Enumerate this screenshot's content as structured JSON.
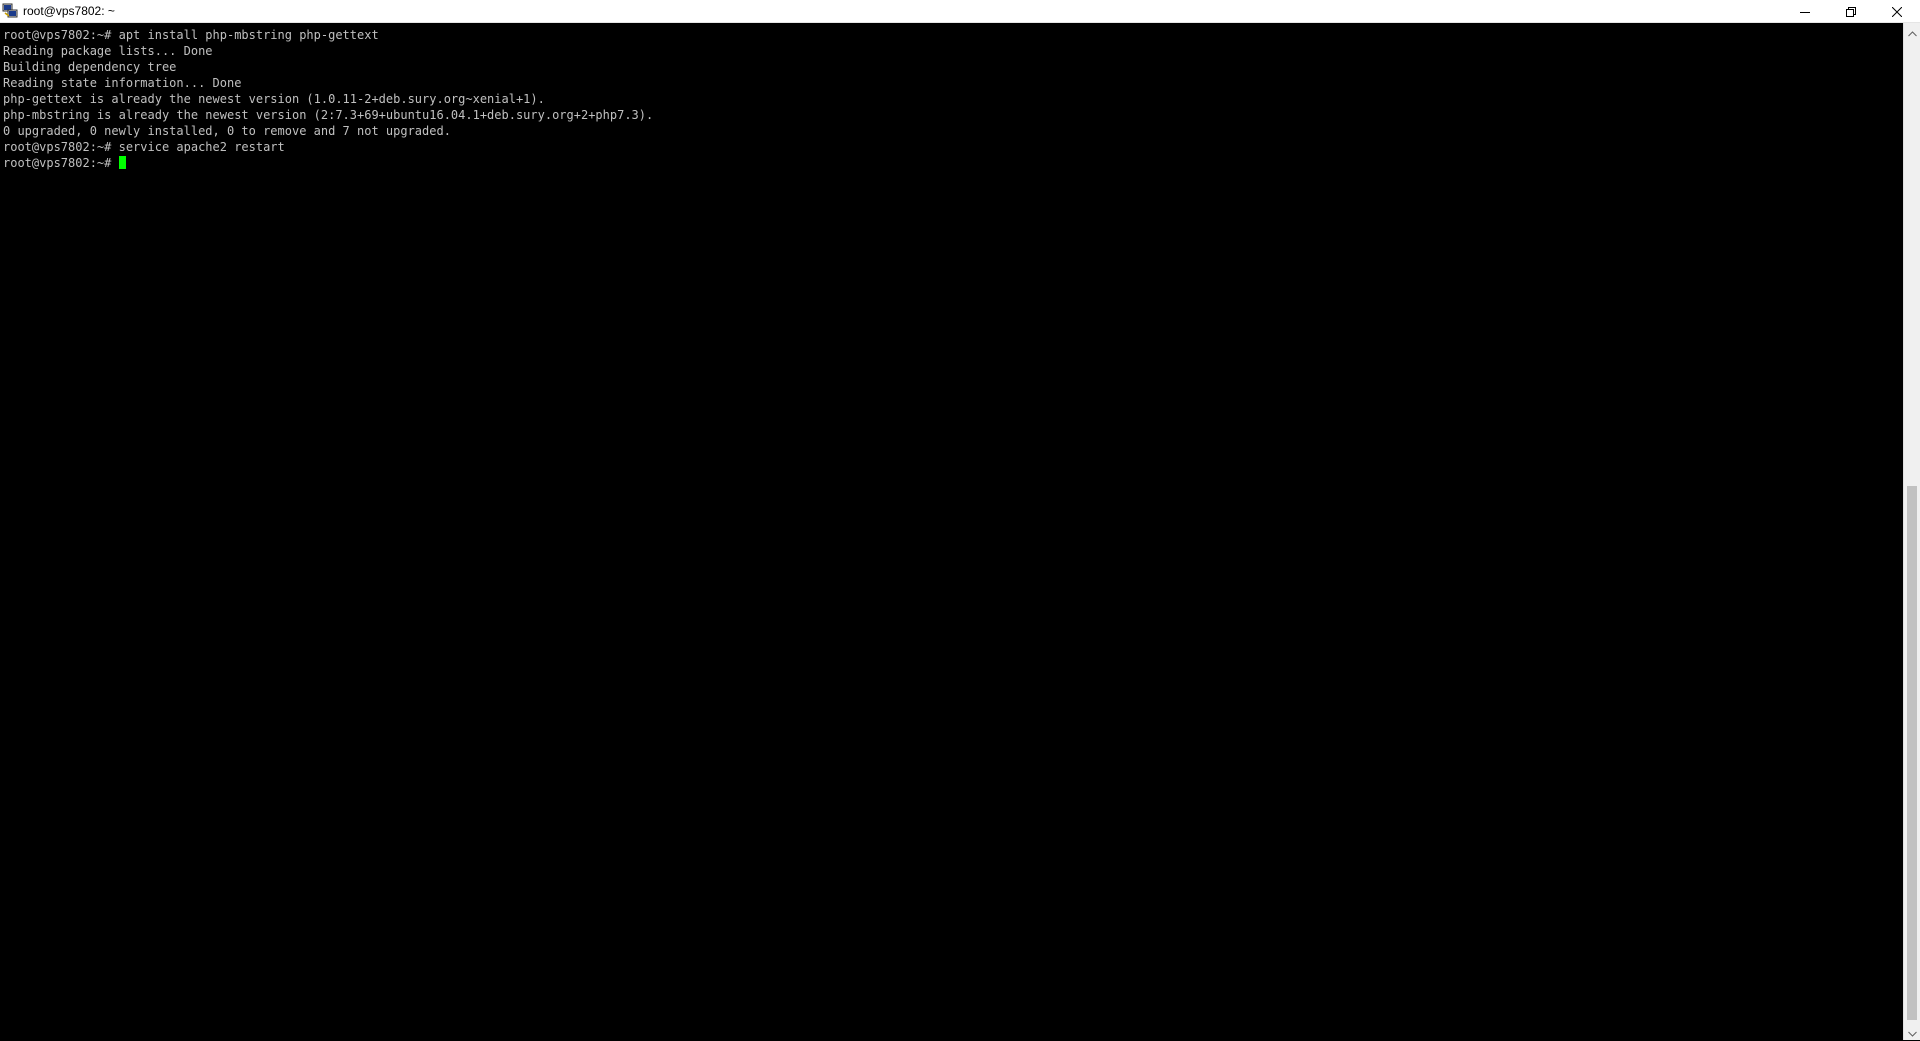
{
  "window": {
    "title": "root@vps7802: ~",
    "app_icon": "putty-icon",
    "controls": {
      "minimize_icon": "minimize-icon",
      "restore_icon": "restore-icon",
      "close_icon": "close-icon"
    }
  },
  "terminal": {
    "lines": [
      "root@vps7802:~# apt install php-mbstring php-gettext",
      "Reading package lists... Done",
      "Building dependency tree",
      "Reading state information... Done",
      "php-gettext is already the newest version (1.0.11-2+deb.sury.org~xenial+1).",
      "php-mbstring is already the newest version (2:7.3+69+ubuntu16.04.1+deb.sury.org+2+php7.3).",
      "0 upgraded, 0 newly installed, 0 to remove and 7 not upgraded.",
      "root@vps7802:~# service apache2 restart"
    ],
    "prompt": "root@vps7802:~# ",
    "colors": {
      "background": "#000000",
      "foreground": "#c0c0c0",
      "cursor": "#00ff00"
    }
  }
}
